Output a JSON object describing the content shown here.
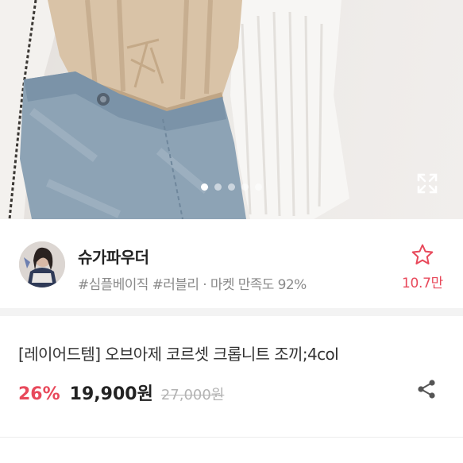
{
  "product_image": {
    "slide_count": 5,
    "active_slide": 1,
    "expand_icon": "expand-icon"
  },
  "shop": {
    "name": "슈가파우더",
    "meta": "#심플베이직 #러블리 · 마켓 만족도 92%",
    "favorite_icon": "star-outline-icon",
    "favorite_count": "10.7만"
  },
  "product": {
    "title": "[레이어드템] 오브아제 코르셋 크롭니트 조끼;4col",
    "discount": "26%",
    "price": "19,900원",
    "original_price": "27,000원",
    "share_icon": "share-icon"
  },
  "colors": {
    "accent": "#e8495b",
    "text": "#222222",
    "muted": "#8a8a8a",
    "strike": "#b3b3b3"
  }
}
